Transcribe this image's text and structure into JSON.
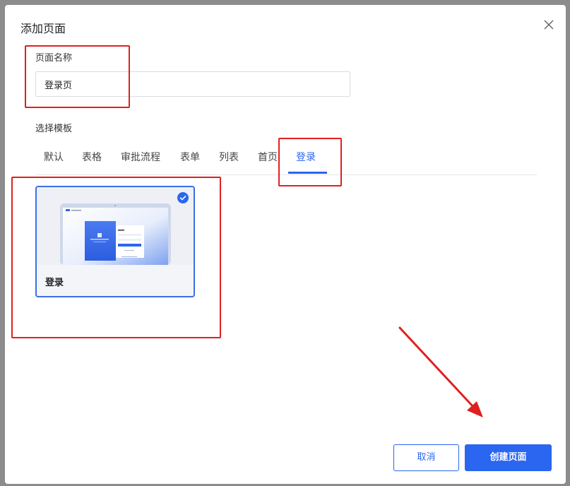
{
  "dialog": {
    "title": "添加页面",
    "close_icon": "close-icon"
  },
  "form": {
    "page_name_label": "页面名称",
    "page_name_value": "登录页",
    "template_label": "选择模板"
  },
  "tabs": [
    {
      "label": "默认",
      "active": false
    },
    {
      "label": "表格",
      "active": false
    },
    {
      "label": "审批流程",
      "active": false
    },
    {
      "label": "表单",
      "active": false
    },
    {
      "label": "列表",
      "active": false
    },
    {
      "label": "首页",
      "active": false
    },
    {
      "label": "登录",
      "active": true
    }
  ],
  "template_cards": [
    {
      "label": "登录",
      "selected": true,
      "icon": "check-circle-icon"
    }
  ],
  "buttons": {
    "cancel": "取消",
    "create": "创建页面"
  },
  "colors": {
    "accent": "#2b66f0",
    "annotation": "#e02020"
  }
}
